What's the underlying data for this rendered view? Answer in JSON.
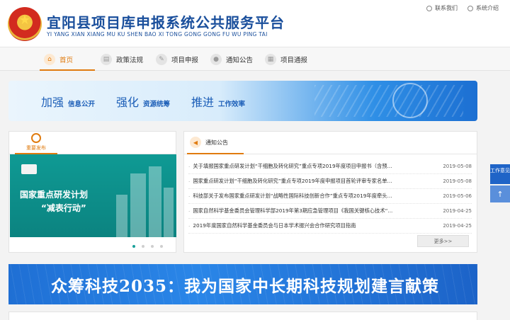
{
  "header": {
    "title": "宜阳县项目库申报系统公共服务平台",
    "subtitle": "YI YANG XIAN XIANG MU KU SHEN BAO XI TONG GONG GONG FU WU PING TAI",
    "links": [
      "联系我们",
      "系统介绍"
    ]
  },
  "nav": {
    "items": [
      "首页",
      "政策法规",
      "项目申报",
      "通知公告",
      "项目通报"
    ]
  },
  "banner1": {
    "words": [
      {
        "big": "加强",
        "small": "信息公开"
      },
      {
        "big": "强化",
        "small": "资源统筹"
      },
      {
        "big": "推进",
        "small": "工作效率"
      }
    ]
  },
  "left_panel": {
    "tab_label": "重要发布",
    "slide_title": "国家重点研发计划",
    "slide_subtitle": "“减表行动”"
  },
  "right_panel": {
    "tab_label": "通知公告",
    "news": [
      {
        "title": "关于填报国家重点研发计划“干细胞及转化研究”重点专项2019年度项目申报书（含预...",
        "date": "2019-05-08"
      },
      {
        "title": "国家重点研发计划“干细胞及转化研究”重点专项2019年度申报项目首轮评审专家名单...",
        "date": "2019-05-08"
      },
      {
        "title": "科技部关于发布国家重点研发计划“战略性国际科技创新合作”重点专项2019年度牵头...",
        "date": "2019-05-06"
      },
      {
        "title": "国家自然科学基金委员会管理科学部2019年第3期应急管理项目《我国关键核心技术“...",
        "date": "2019-04-25"
      },
      {
        "title": "2019年度国家自然科学基金委员会与日本学术振兴会合作研究项目指南",
        "date": "2019-04-25"
      }
    ],
    "more_label": "更多>>"
  },
  "banner2": {
    "text": "众筹科技2035：我为国家中长期科技规划建言献策"
  },
  "float": {
    "feedback_label": "工作意见",
    "top_label": "↑"
  }
}
